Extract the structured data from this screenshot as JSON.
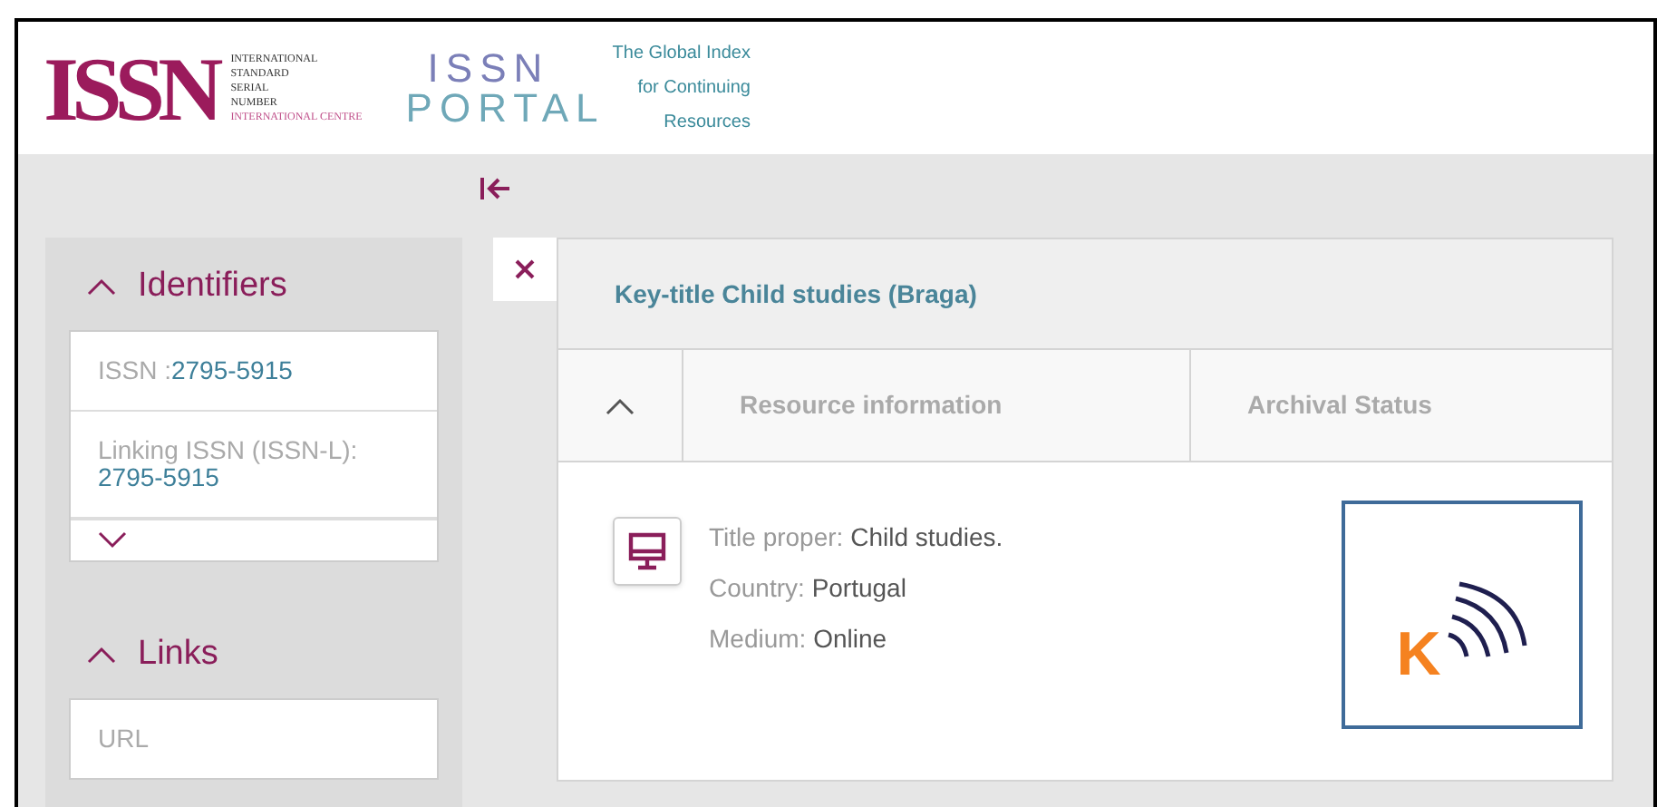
{
  "header": {
    "issn_logo": {
      "mark": "ISSN",
      "lines": [
        "INTERNATIONAL",
        "STANDARD",
        "SERIAL",
        "NUMBER",
        "INTERNATIONAL CENTRE"
      ]
    },
    "portal_logo": {
      "top": "ISSN",
      "bottom": "PORTAL",
      "tagline": [
        "The Global Index",
        "for Continuing",
        "Resources"
      ]
    }
  },
  "sidebar": {
    "sections": [
      {
        "title": "Identifiers",
        "expanded": true,
        "items": [
          {
            "kind": "inline",
            "label": "ISSN :",
            "value": "2795-5915"
          },
          {
            "kind": "stacked",
            "label": "Linking ISSN (ISSN-L):",
            "value": "2795-5915"
          }
        ],
        "more": true
      },
      {
        "title": "Links",
        "expanded": true,
        "items": [
          {
            "kind": "label",
            "label": "URL"
          }
        ],
        "more": false
      }
    ]
  },
  "record": {
    "title": "Key-title Child studies (Braga)",
    "tabs": [
      {
        "label": "Resource information",
        "selected": false
      },
      {
        "label": "Archival Status",
        "selected": false
      }
    ],
    "fields": [
      {
        "label": "Title proper:",
        "value": "Child studies."
      },
      {
        "label": "Country:",
        "value": "Portugal"
      },
      {
        "label": "Medium:",
        "value": "Online"
      }
    ],
    "archive_logo": {
      "letter": "K"
    }
  }
}
